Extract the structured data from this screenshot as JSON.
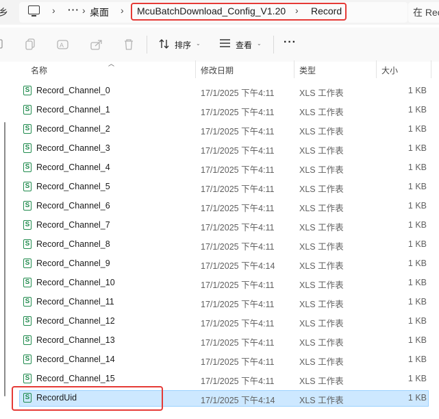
{
  "address_bar": {
    "left_cut": "乡",
    "more": "···",
    "desktop": "桌面",
    "folder": "McuBatchDownload_Config_V1.20",
    "subfolder": "Record",
    "search_cut": "在 Rec"
  },
  "toolbar": {
    "sort_label": "排序",
    "view_label": "查看",
    "more": "···"
  },
  "columns": {
    "name": "名称",
    "date": "修改日期",
    "type": "类型",
    "size": "大小"
  },
  "files": [
    {
      "name": "Record_Channel_0",
      "date": "17/1/2025 下午4:11",
      "type": "XLS 工作表",
      "size": "1 KB"
    },
    {
      "name": "Record_Channel_1",
      "date": "17/1/2025 下午4:11",
      "type": "XLS 工作表",
      "size": "1 KB"
    },
    {
      "name": "Record_Channel_2",
      "date": "17/1/2025 下午4:11",
      "type": "XLS 工作表",
      "size": "1 KB"
    },
    {
      "name": "Record_Channel_3",
      "date": "17/1/2025 下午4:11",
      "type": "XLS 工作表",
      "size": "1 KB"
    },
    {
      "name": "Record_Channel_4",
      "date": "17/1/2025 下午4:11",
      "type": "XLS 工作表",
      "size": "1 KB"
    },
    {
      "name": "Record_Channel_5",
      "date": "17/1/2025 下午4:11",
      "type": "XLS 工作表",
      "size": "1 KB"
    },
    {
      "name": "Record_Channel_6",
      "date": "17/1/2025 下午4:11",
      "type": "XLS 工作表",
      "size": "1 KB"
    },
    {
      "name": "Record_Channel_7",
      "date": "17/1/2025 下午4:11",
      "type": "XLS 工作表",
      "size": "1 KB"
    },
    {
      "name": "Record_Channel_8",
      "date": "17/1/2025 下午4:11",
      "type": "XLS 工作表",
      "size": "1 KB"
    },
    {
      "name": "Record_Channel_9",
      "date": "17/1/2025 下午4:14",
      "type": "XLS 工作表",
      "size": "1 KB"
    },
    {
      "name": "Record_Channel_10",
      "date": "17/1/2025 下午4:11",
      "type": "XLS 工作表",
      "size": "1 KB"
    },
    {
      "name": "Record_Channel_11",
      "date": "17/1/2025 下午4:11",
      "type": "XLS 工作表",
      "size": "1 KB"
    },
    {
      "name": "Record_Channel_12",
      "date": "17/1/2025 下午4:11",
      "type": "XLS 工作表",
      "size": "1 KB"
    },
    {
      "name": "Record_Channel_13",
      "date": "17/1/2025 下午4:11",
      "type": "XLS 工作表",
      "size": "1 KB"
    },
    {
      "name": "Record_Channel_14",
      "date": "17/1/2025 下午4:11",
      "type": "XLS 工作表",
      "size": "1 KB"
    },
    {
      "name": "Record_Channel_15",
      "date": "17/1/2025 下午4:11",
      "type": "XLS 工作表",
      "size": "1 KB"
    },
    {
      "name": "RecordUid",
      "date": "17/1/2025 下午4:14",
      "type": "XLS 工作表",
      "size": "1 KB",
      "selected": true
    }
  ],
  "file_icon_letter": "S",
  "colors": {
    "highlight_red": "#e53935",
    "selection_bg": "#cde8ff",
    "excel_green": "#1e8a4c"
  }
}
